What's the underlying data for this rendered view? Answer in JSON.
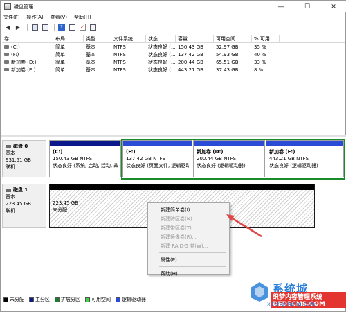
{
  "window": {
    "title": "磁盘管理",
    "controls": [
      "—",
      "☐",
      "✕"
    ]
  },
  "menu": [
    "文件(F)",
    "操作(A)",
    "查看(V)",
    "帮助(H)"
  ],
  "toolbar": {
    "icons": [
      "back-arrow-icon",
      "forward-arrow-icon",
      "console-tree-icon",
      "help-icon",
      "properties-icon",
      "check-icon",
      "list-icon"
    ]
  },
  "volumes": {
    "headers": [
      "卷",
      "布局",
      "类型",
      "文件系统",
      "状态",
      "容量",
      "可用空间",
      "% 可用"
    ],
    "rows": [
      [
        "(C:)",
        "简单",
        "基本",
        "NTFS",
        "状态良好 (...",
        "150.43 GB",
        "52.97 GB",
        "35 %"
      ],
      [
        "(F:)",
        "简单",
        "基本",
        "NTFS",
        "状态良好 (...",
        "137.42 GB",
        "54.93 GB",
        "40 %"
      ],
      [
        "新加卷 (D:)",
        "简单",
        "基本",
        "NTFS",
        "状态良好 (...",
        "200.44 GB",
        "65.51 GB",
        "33 %"
      ],
      [
        "新加卷 (E:)",
        "简单",
        "基本",
        "NTFS",
        "状态良好 (...",
        "443.21 GB",
        "37.43 GB",
        "8 %"
      ]
    ]
  },
  "disks": [
    {
      "name": "磁盘 0",
      "type": "基本",
      "size": "931.51 GB",
      "status": "联机",
      "partitions": [
        {
          "name": "(C:)",
          "size": "150.43 GB NTFS",
          "status": "状态良好 (系统, 启动, 活动, 故)"
        },
        {
          "name": "(F:)",
          "size": "137.42 GB NTFS",
          "status": "状态良好 (页面文件, 逻辑驱动"
        },
        {
          "name": "新加卷 (D:)",
          "size": "200.44 GB NTFS",
          "status": "状态良好 (逻辑驱动器)"
        },
        {
          "name": "新加卷 (E:)",
          "size": "443.21 GB NTFS",
          "status": "状态良好 (逻辑驱动器)"
        }
      ]
    },
    {
      "name": "磁盘 1",
      "type": "基本",
      "size": "223.45 GB",
      "status": "联机",
      "partitions": [
        {
          "size": "223.45 GB",
          "status": "未分配"
        }
      ]
    }
  ],
  "legend": [
    {
      "label": "未分配",
      "color": "#000000"
    },
    {
      "label": "主分区",
      "color": "#0a1a8c"
    },
    {
      "label": "扩展分区",
      "color": "#1e7d2c"
    },
    {
      "label": "可用空间",
      "color": "#3fd43f"
    },
    {
      "label": "逻辑驱动器",
      "color": "#2a4bd6"
    }
  ],
  "context_menu": {
    "items": [
      {
        "label": "新建简单卷(I)...",
        "disabled": false
      },
      {
        "label": "新建跨区卷(N)...",
        "disabled": true
      },
      {
        "label": "新建带区卷(T)...",
        "disabled": true
      },
      {
        "label": "新建镜像卷(R)...",
        "disabled": true
      },
      {
        "label": "新建 RAID-5 卷(W)...",
        "disabled": true
      },
      {
        "label": "属性(P)",
        "disabled": false
      },
      {
        "label": "帮助(H)",
        "disabled": false
      }
    ]
  },
  "watermark": {
    "line1": "系统城",
    "line2": "xitongcheng.com",
    "line3": "织梦内容管理系统 DEDECMS.COM"
  },
  "colors": {
    "primary_bar": "#0a1a8c",
    "logical_bar": "#2a4bd6",
    "unallocated_bar": "#000000",
    "selection": "#1b8a2a",
    "arrow": "#e04848"
  }
}
